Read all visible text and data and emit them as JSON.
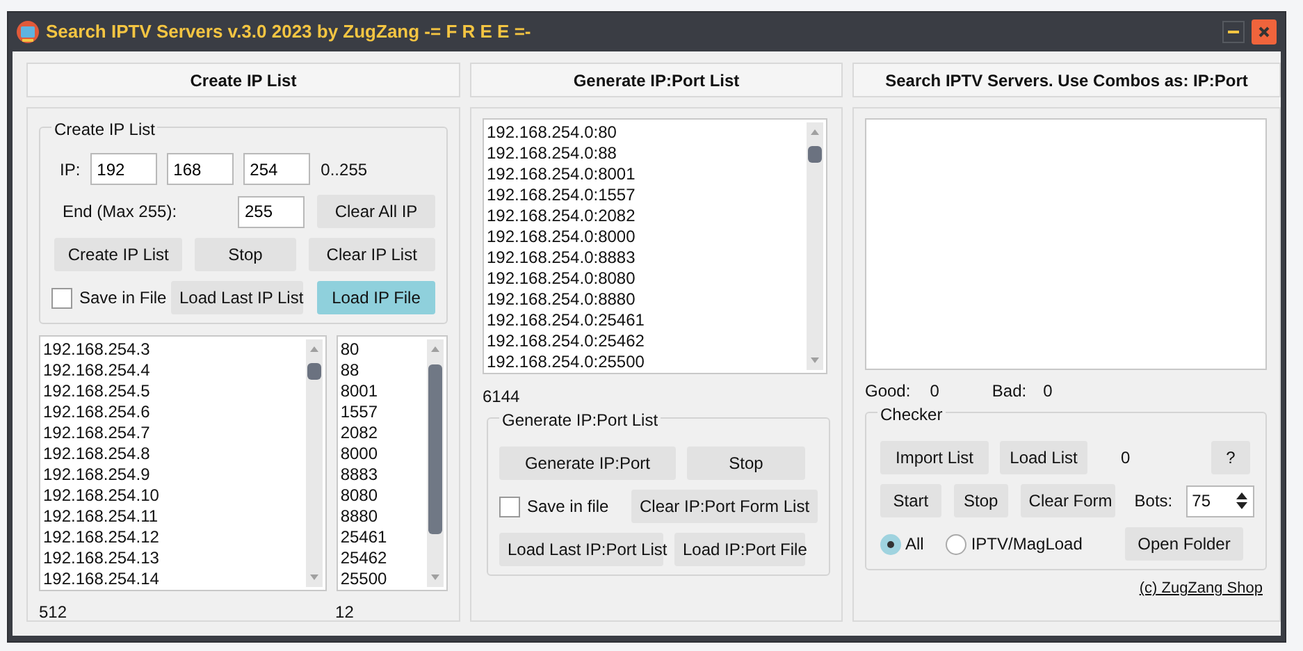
{
  "window": {
    "title": "Search IPTV Servers v.3.0 2023 by ZugZang -= F R E E =-"
  },
  "create_panel": {
    "header": "Create IP List",
    "group_title": "Create IP List",
    "ip_label": "IP:",
    "octets": [
      "192",
      "168",
      "254"
    ],
    "range_hint": "0..255",
    "end_label": "End (Max 255):",
    "end_value": "255",
    "buttons": [
      {
        "label": "Clear All IP",
        "highlighted": false
      },
      {
        "label": "Create IP List",
        "highlighted": false
      },
      {
        "label": "Stop",
        "highlighted": false
      },
      {
        "label": "Clear IP List",
        "highlighted": false
      },
      {
        "label": "Load Last IP List",
        "highlighted": false
      },
      {
        "label": "Load IP File",
        "highlighted": true
      }
    ],
    "save_checkbox": {
      "label": "Save in File",
      "checked": false
    },
    "ip_list": [
      "192.168.254.3",
      "192.168.254.4",
      "192.168.254.5",
      "192.168.254.6",
      "192.168.254.7",
      "192.168.254.8",
      "192.168.254.9",
      "192.168.254.10",
      "192.168.254.11",
      "192.168.254.12",
      "192.168.254.13",
      "192.168.254.14"
    ],
    "port_list": [
      "80",
      "88",
      "8001",
      "1557",
      "2082",
      "8000",
      "8883",
      "8080",
      "8880",
      "25461",
      "25462",
      "25500"
    ],
    "ip_count": "512",
    "port_count": "12"
  },
  "generate_panel": {
    "header": "Generate IP:Port List",
    "list": [
      "192.168.254.0:80",
      "192.168.254.0:88",
      "192.168.254.0:8001",
      "192.168.254.0:1557",
      "192.168.254.0:2082",
      "192.168.254.0:8000",
      "192.168.254.0:8883",
      "192.168.254.0:8080",
      "192.168.254.0:8880",
      "192.168.254.0:25461",
      "192.168.254.0:25462",
      "192.168.254.0:25500"
    ],
    "count": "6144",
    "group_title": "Generate IP:Port List",
    "buttons": [
      {
        "label": "Generate IP:Port",
        "highlighted": false
      },
      {
        "label": "Stop",
        "highlighted": false
      },
      {
        "label": "Clear IP:Port Form List",
        "highlighted": false
      },
      {
        "label": "Load Last IP:Port List",
        "highlighted": false
      },
      {
        "label": "Load IP:Port File",
        "highlighted": false
      }
    ],
    "save_checkbox": {
      "label": "Save in file",
      "checked": false
    }
  },
  "search_panel": {
    "header": "Search IPTV Servers. Use Combos as: IP:Port",
    "good_label": "Good:",
    "good_value": "0",
    "bad_label": "Bad:",
    "bad_value": "0",
    "group_title": "Checker",
    "buttons": [
      {
        "label": "Import List",
        "highlighted": false
      },
      {
        "label": "Load List",
        "highlighted": false
      },
      {
        "label": "?",
        "highlighted": false
      },
      {
        "label": "Start",
        "highlighted": false
      },
      {
        "label": "Stop",
        "highlighted": false
      },
      {
        "label": "Clear Form",
        "highlighted": false
      },
      {
        "label": "Open Folder",
        "highlighted": false
      }
    ],
    "loaded_count": "0",
    "bots_label": "Bots:",
    "bots_value": "75",
    "radios": [
      {
        "label": "All",
        "selected": true
      },
      {
        "label": "IPTV/MagLoad",
        "selected": false
      }
    ],
    "footer_link": "(c) ZugZang Shop"
  }
}
